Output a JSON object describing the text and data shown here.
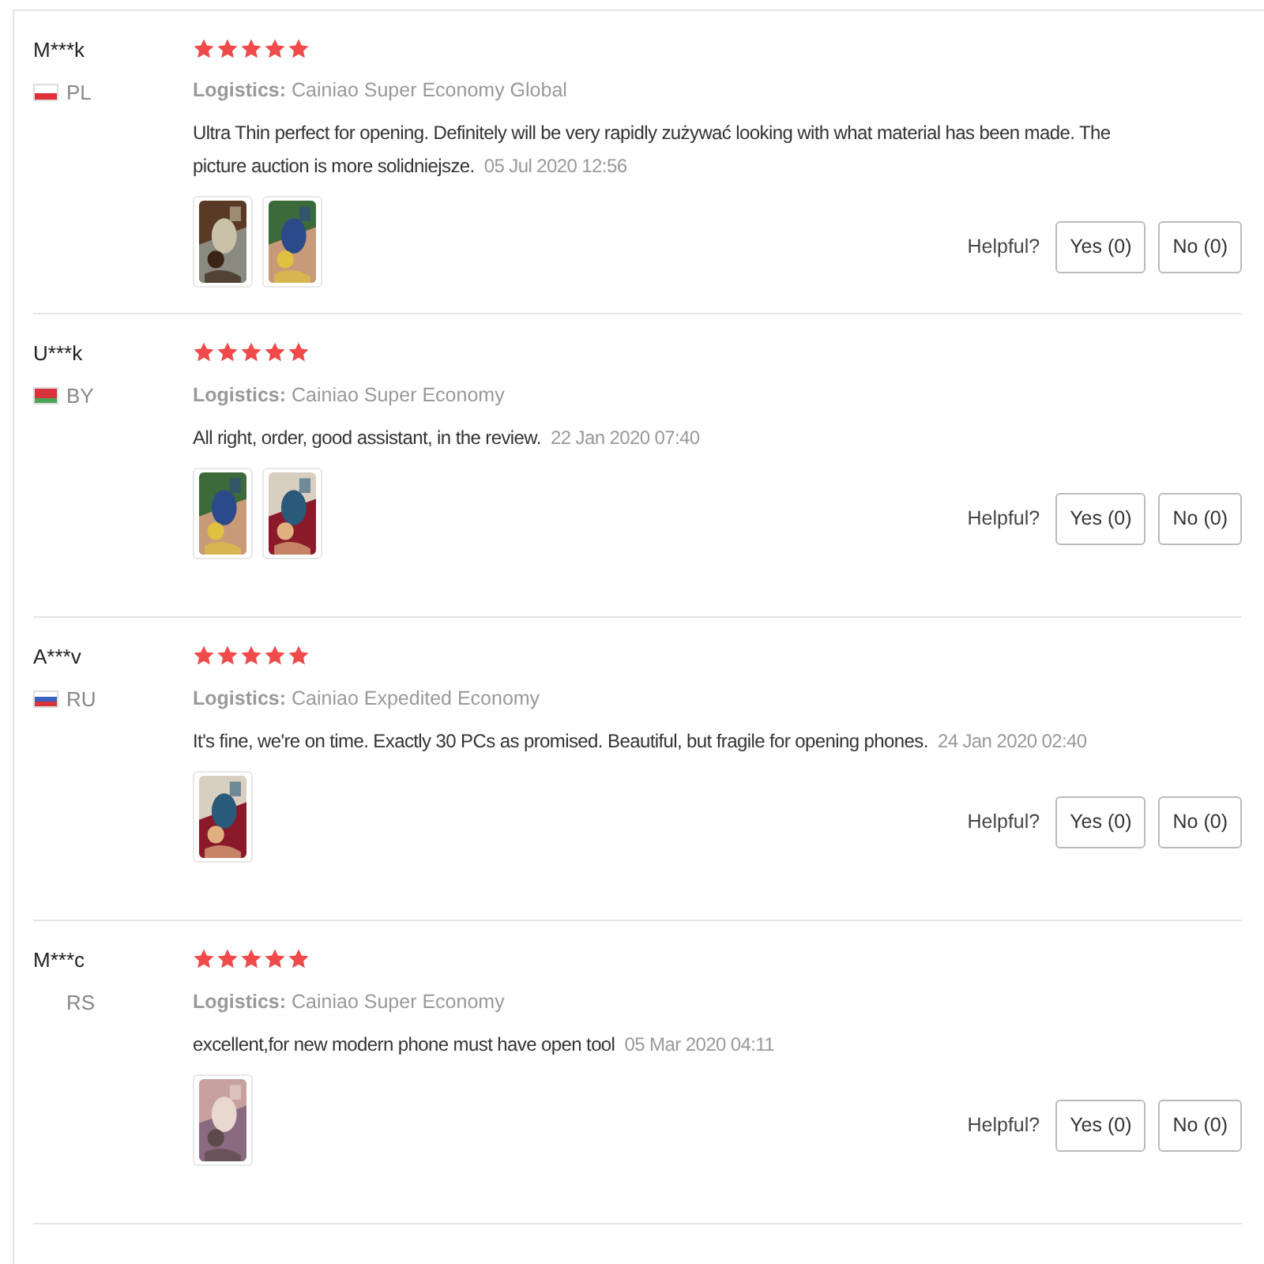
{
  "reviews": [
    {
      "user": "M***k",
      "country": "PL",
      "flag": [
        {
          "color": "#ffffff"
        },
        {
          "color": "#e0303a"
        }
      ],
      "stars": 5,
      "logistics_label": "Logistics:",
      "logistics": "Cainiao Super Economy Global",
      "text": "Ultra Thin perfect for opening. Definitely will be very rapidly zużywać looking with what material has been made. The picture auction is more solidniejsze.",
      "date": "05 Jul 2020 12:56",
      "photos": [
        {
          "kind": "picture"
        },
        {
          "kind": "picture"
        }
      ],
      "helpful": "Helpful?",
      "yes": "Yes (0)",
      "no": "No (0)"
    },
    {
      "user": "U***k",
      "country": "BY",
      "flag": [
        {
          "color": "#d8333b"
        },
        {
          "color": "#d8333b"
        },
        {
          "color": "#4aa657"
        }
      ],
      "stars": 5,
      "logistics_label": "Logistics:",
      "logistics": "Cainiao Super Economy",
      "text": "All right, order, good assistant, in the review.",
      "date": "22 Jan 2020 07:40",
      "photos": [
        {
          "kind": "picture"
        },
        {
          "kind": "picture"
        }
      ],
      "helpful": "Helpful?",
      "yes": "Yes (0)",
      "no": "No (0)"
    },
    {
      "user": "A***v",
      "country": "RU",
      "flag": [
        {
          "color": "#ffffff"
        },
        {
          "color": "#3a62c0"
        },
        {
          "color": "#d8333b"
        }
      ],
      "stars": 5,
      "logistics_label": "Logistics:",
      "logistics": "Cainiao Expedited Economy",
      "text": "It's fine, we're on time. Exactly 30 PCs as promised. Beautiful, but fragile for opening phones.",
      "date": "24 Jan 2020 02:40",
      "photos": [
        {
          "kind": "picture"
        }
      ],
      "helpful": "Helpful?",
      "yes": "Yes (0)",
      "no": "No (0)"
    },
    {
      "user": "M***c",
      "country": "RS",
      "stars": 5,
      "logistics_label": "Logistics:",
      "logistics": "Cainiao Super Economy",
      "text": "excellent,for new modern phone must have open tool",
      "date": "05 Mar 2020 04:11",
      "photos": [
        {
          "kind": "picture"
        }
      ],
      "helpful": "Helpful?",
      "yes": "Yes (0)",
      "no": "No (0)"
    }
  ]
}
